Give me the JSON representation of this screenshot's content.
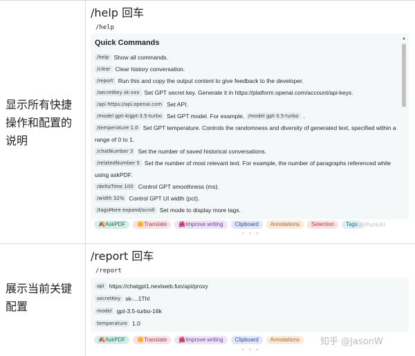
{
  "row1": {
    "description": "显示所有快捷操作和配置的说明",
    "description_lines": [
      "显示所有快捷",
      "操作和配置的",
      "说明"
    ],
    "title": "/help 回车",
    "code": "/help",
    "panel": {
      "heading": "Quick Commands",
      "items": [
        {
          "chips": [
            "/help"
          ],
          "text": "Show all commands."
        },
        {
          "chips": [
            "/clear"
          ],
          "text": "Clear history conversation."
        },
        {
          "chips": [
            "/report"
          ],
          "text": "Run this and copy the output content to give feedback to the developer."
        },
        {
          "chips": [
            "/secretKey sk-xxx"
          ],
          "text": "Set GPT secret key. Generate it in https://platform.openai.com/account/api-keys."
        },
        {
          "chips": [
            "/api https://api.openai.com"
          ],
          "text": "Set API."
        },
        {
          "chips": [
            "/model gpt-4/gpt-3.5-turbo"
          ],
          "text": "Set GPT model. For example,",
          "chip2": "/model gpt-3.5-turbo",
          "tail": "."
        },
        {
          "chips": [
            "/temperature 1.0"
          ],
          "text": "Set GPT temperature. Controls the randomness and diversity of generated text, specified within a range of 0 to 1."
        },
        {
          "chips": [
            "/chatNumber 3"
          ],
          "text": "Set the number of saved historical conversations."
        },
        {
          "chips": [
            "/relatedNumber 5"
          ],
          "text": "Set the number of most relevant text. For example, the number of paragraphs referenced while using askPDF."
        },
        {
          "chips": [
            "/deltaTime 100"
          ],
          "text": "Control GPT smoothness (ms)."
        },
        {
          "chips": [
            "/width 32%"
          ],
          "text": "Control GPT UI width (pct)."
        },
        {
          "chips": [
            "/tagsMore expand/scroll"
          ],
          "text": "Set mode to display more tags."
        }
      ]
    },
    "toolbar": [
      "🍂AskPDF",
      "🌼Translate",
      "🌺Improve writing",
      "Clipboard",
      "Annotations",
      "Selection",
      "Tags"
    ],
    "watermark": "@PureAI"
  },
  "row2": {
    "description": "展示当前关键配置",
    "description_lines": [
      "展示当前关键",
      "配置"
    ],
    "title": "/report 回车",
    "code": "/report",
    "stats": [
      {
        "key": "api",
        "value": "https://chatgpt1.nextweb.fun/api/proxy"
      },
      {
        "key": "secretKey",
        "value": "sk-...1Thl"
      },
      {
        "key": "model",
        "value": "gpt-3.5-turbo-16k"
      },
      {
        "key": "temperature",
        "value": "1.0"
      }
    ],
    "toolbar": [
      "🍂AskPDF",
      "🌼Translate",
      "🌺Improve writing",
      "Clipboard",
      "Annotations"
    ],
    "watermark": "知乎 @JasonW"
  }
}
